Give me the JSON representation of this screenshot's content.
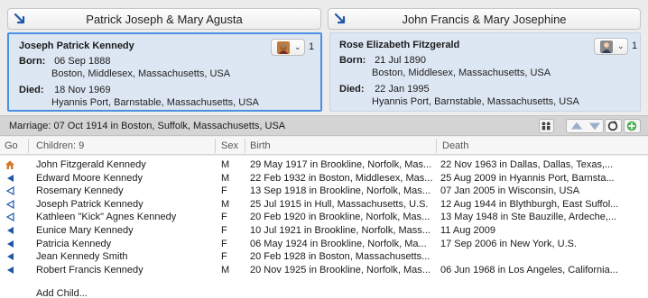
{
  "parents": {
    "husband_parents": "Patrick Joseph & Mary Agusta",
    "wife_parents": "John Francis & Mary Josephine"
  },
  "husband": {
    "name": "Joseph Patrick Kennedy",
    "born_label": "Born:",
    "born_date": "06 Sep 1888",
    "born_place": "Boston, Middlesex, Massachusetts, USA",
    "died_label": "Died:",
    "died_date": "18 Nov 1969",
    "died_place": "Hyannis Port, Barnstable, Massachusetts, USA",
    "spouse_count": "1",
    "gender_icon": "male-person-icon"
  },
  "wife": {
    "name": "Rose Elizabeth Fitzgerald",
    "born_label": "Born:",
    "born_date": "21 Jul 1890",
    "born_place": "Boston, Middlesex, Massachusetts, USA",
    "died_label": "Died:",
    "died_date": "22 Jan 1995",
    "died_place": "Hyannis Port, Barnstable, Massachusetts, USA",
    "spouse_count": "1",
    "gender_icon": "female-person-icon"
  },
  "marriage": {
    "text": "Marriage: 07 Oct 1914 in Boston, Suffolk, Massachusetts, USA"
  },
  "colors": {
    "card_bg": "#dde7f3",
    "selected_border": "#4a90e2",
    "arrow_blue": "#1f57a8"
  },
  "children_table": {
    "headers": {
      "go": "Go",
      "children": "Children: 9",
      "sex": "Sex",
      "birth": "Birth",
      "death": "Death"
    },
    "rows": [
      {
        "icon": "home-icon",
        "name": "John Fitzgerald Kennedy",
        "sex": "M",
        "birth": "29 May 1917 in Brookline, Norfolk, Mas...",
        "death": "22 Nov 1963 in Dallas, Dallas, Texas,..."
      },
      {
        "icon": "go-arrow-filled-icon",
        "name": "Edward Moore Kennedy",
        "sex": "M",
        "birth": "22 Feb 1932 in Boston, Middlesex, Mas...",
        "death": "25 Aug 2009 in Hyannis Port, Barnsta..."
      },
      {
        "icon": "go-arrow-outline-icon",
        "name": "Rosemary Kennedy",
        "sex": "F",
        "birth": "13 Sep 1918 in Brookline, Norfolk, Mas...",
        "death": "07 Jan 2005 in Wisconsin, USA"
      },
      {
        "icon": "go-arrow-outline-icon",
        "name": "Joseph Patrick Kennedy",
        "sex": "M",
        "birth": "25 Jul 1915 in Hull, Massachusetts, U.S.",
        "death": "12 Aug 1944 in Blythburgh, East Suffol..."
      },
      {
        "icon": "go-arrow-outline-icon",
        "name": "Kathleen \"Kick\" Agnes Kennedy",
        "sex": "F",
        "birth": "20 Feb 1920 in Brookline, Norfolk, Mas...",
        "death": "13 May 1948 in Ste Bauzille, Ardeche,..."
      },
      {
        "icon": "go-arrow-filled-icon",
        "name": "Eunice Mary Kennedy",
        "sex": "F",
        "birth": "10 Jul 1921 in Brookline, Norfolk, Mass...",
        "death": "11 Aug 2009"
      },
      {
        "icon": "go-arrow-filled-icon",
        "name": "Patricia Kennedy",
        "sex": "F",
        "birth": "06 May 1924 in Brookline, Norfolk, Ma...",
        "death": "17 Sep 2006 in New York, U.S."
      },
      {
        "icon": "go-arrow-filled-icon",
        "name": "Jean Kennedy Smith",
        "sex": "F",
        "birth": "20 Feb 1928 in Boston, Massachusetts...",
        "death": ""
      },
      {
        "icon": "go-arrow-filled-icon",
        "name": "Robert Francis Kennedy",
        "sex": "M",
        "birth": "20 Nov 1925 in Brookline, Norfolk, Mas...",
        "death": "06 Jun 1968 in Los Angeles, California..."
      }
    ],
    "add_child_label": "Add Child..."
  }
}
